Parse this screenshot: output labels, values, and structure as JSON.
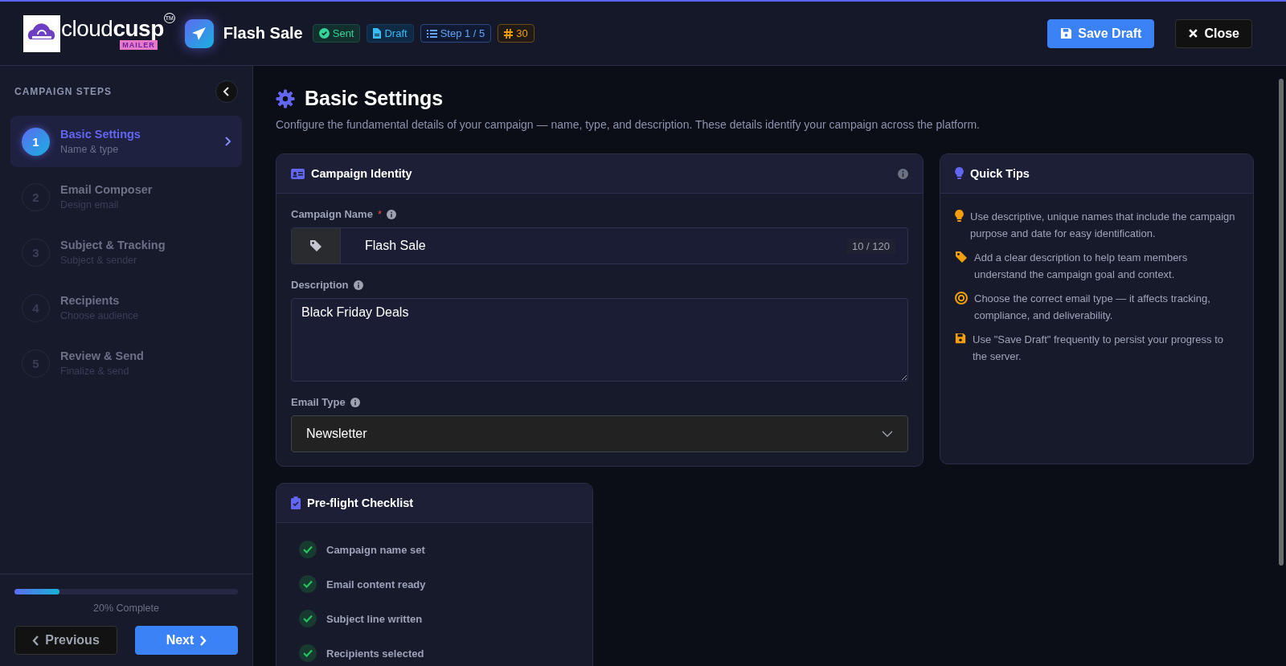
{
  "header": {
    "logo": {
      "wordmark": "cloud**cusp**",
      "trademark": "TM",
      "tagline": "MAILER"
    },
    "title": "Flash Sale",
    "badges": [
      {
        "kind": "sent",
        "label": "Sent"
      },
      {
        "kind": "draft",
        "label": "Draft"
      },
      {
        "kind": "step",
        "label": "Step 1 / 5"
      },
      {
        "kind": "count",
        "label": "30"
      }
    ],
    "buttons": [
      {
        "kind": "primary",
        "label": "Save Draft"
      },
      {
        "kind": "close",
        "label": "Close"
      }
    ]
  },
  "sidebar": {
    "heading": "CAMPAIGN STEPS",
    "steps": [
      {
        "number": "1",
        "title": "Basic Settings",
        "subtitle": "Name & type",
        "selected": true
      },
      {
        "number": "2",
        "title": "Email Composer",
        "subtitle": "Design email",
        "selected": false
      },
      {
        "number": "3",
        "title": "Subject & Tracking",
        "subtitle": "Subject & sender",
        "selected": false
      },
      {
        "number": "4",
        "title": "Recipients",
        "subtitle": "Choose audience",
        "selected": false
      },
      {
        "number": "5",
        "title": "Review & Send",
        "subtitle": "Finalize & send",
        "selected": false
      }
    ],
    "progress": {
      "level": 0.2,
      "label": "20% Complete"
    },
    "previous": "Previous",
    "next": "Next"
  },
  "main": {
    "title": "Basic Settings",
    "description": "Configure the fundamental details of your campaign — name, type, and description. These details identify your campaign across the platform.",
    "identity": {
      "title": "Campaign Identity",
      "name_field": {
        "label": "Campaign Name",
        "required_mark": "*",
        "value": "Flash Sale",
        "counter": "10 / 120"
      },
      "description_field": {
        "label": "Description",
        "value": "Black Friday Deals"
      },
      "type_field": {
        "label": "Email Type",
        "value": "Newsletter"
      }
    },
    "tips": {
      "title": "Quick Tips",
      "items": [
        {
          "kind": "bulb",
          "text": "Use descriptive, unique names that include the campaign purpose and date for easy identification."
        },
        {
          "kind": "tag",
          "text": "Add a clear description to help team members understand the campaign goal and context."
        },
        {
          "kind": "target",
          "text": "Choose the correct email type — it affects tracking, compliance, and deliverability."
        },
        {
          "kind": "save",
          "text": "Use \"Save Draft\" frequently to persist your progress to the server."
        }
      ]
    },
    "checklist": {
      "title": "Pre-flight Checklist",
      "items": [
        {
          "label": "Campaign name set",
          "checked": true
        },
        {
          "label": "Email content ready",
          "checked": true
        },
        {
          "label": "Subject line written",
          "checked": true
        },
        {
          "label": "Recipients selected",
          "checked": true
        }
      ]
    }
  }
}
